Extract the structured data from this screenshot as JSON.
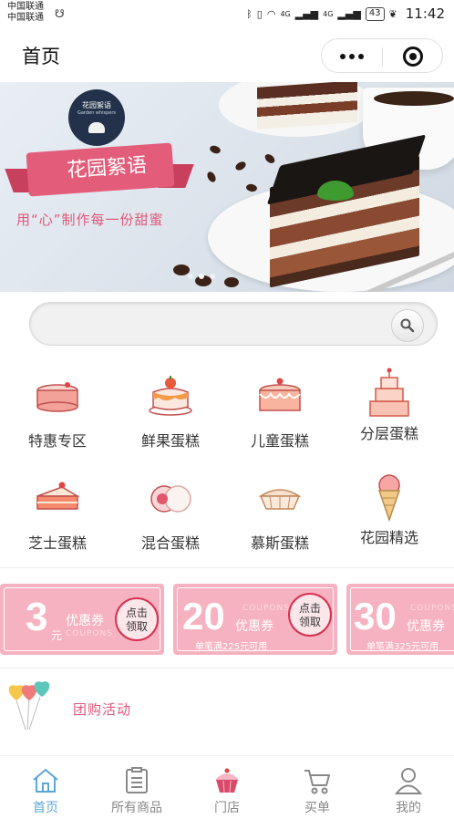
{
  "status_bar": {
    "carrier_1": "中国联通",
    "carrier_2": "中国联通",
    "signal_1": "4G",
    "signal_2": "4G",
    "battery": "43",
    "time": "11:42"
  },
  "nav": {
    "title": "首页"
  },
  "banner": {
    "logo_cn": "花园絮语",
    "logo_en": "Garden whispers",
    "title": "花园絮语",
    "slogan": "用“心”制作每一份甜蜜",
    "slides": 3,
    "active_slide": 1
  },
  "search": {
    "placeholder": ""
  },
  "categories": [
    {
      "label": "特惠专区",
      "icon": "cheesecake-icon"
    },
    {
      "label": "鲜果蛋糕",
      "icon": "fruit-cake-icon"
    },
    {
      "label": "儿童蛋糕",
      "icon": "kids-cake-icon"
    },
    {
      "label": "分层蛋糕",
      "icon": "tiered-cake-icon"
    },
    {
      "label": "芝士蛋糕",
      "icon": "cheese-cake-slice-icon"
    },
    {
      "label": "混合蛋糕",
      "icon": "mochi-icon"
    },
    {
      "label": "慕斯蛋糕",
      "icon": "mousse-pie-icon"
    },
    {
      "label": "花园精选",
      "icon": "ice-cream-cone-icon"
    }
  ],
  "coupons": [
    {
      "amount": "3",
      "unit": "元",
      "type": "优惠券",
      "en": "COUPONS",
      "condition": "",
      "claim": "点击\n领取"
    },
    {
      "amount": "20",
      "unit": "",
      "type": "优惠券",
      "en": "COUPONS",
      "condition": "单笔满225元可用",
      "claim": "点击\n领取"
    },
    {
      "amount": "30",
      "unit": "",
      "type": "优惠券",
      "en": "COUPONS",
      "condition": "单笔满325元可用",
      "claim": ""
    }
  ],
  "group_buy": {
    "label": "团购活动"
  },
  "tabs": [
    {
      "label": "首页",
      "icon": "home-icon",
      "active": true
    },
    {
      "label": "所有商品",
      "icon": "list-icon",
      "active": false
    },
    {
      "label": "门店",
      "icon": "cupcake-icon",
      "active": false
    },
    {
      "label": "买单",
      "icon": "cart-icon",
      "active": false
    },
    {
      "label": "我的",
      "icon": "user-icon",
      "active": false
    }
  ],
  "colors": {
    "accent_pink": "#e3577a",
    "coupon_pink": "#f6b2c0",
    "tab_active": "#5aa6d8"
  }
}
